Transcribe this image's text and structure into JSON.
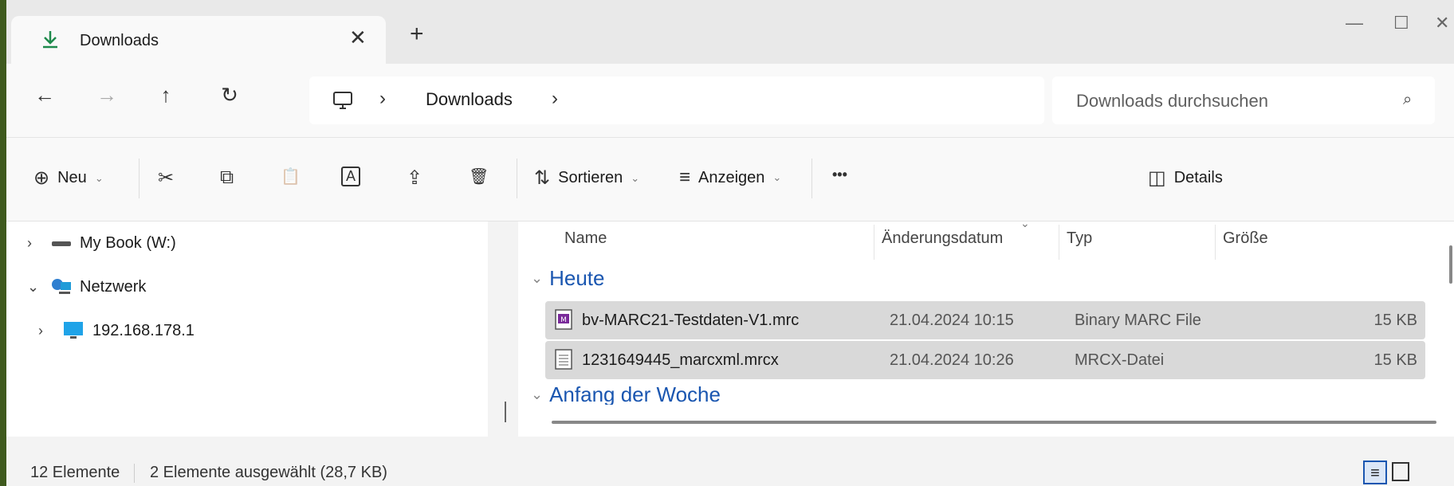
{
  "tab": {
    "title": "Downloads",
    "icon": "download-icon",
    "close": "✕",
    "new": "+"
  },
  "window_controls": {
    "minimize": "—",
    "maximize": "☐",
    "close": "✕"
  },
  "nav": {
    "back": "←",
    "forward": "→",
    "up": "↑",
    "refresh": "↻",
    "breadcrumb_sep": "›",
    "breadcrumb": "Downloads",
    "breadcrumb_end": "›",
    "search_placeholder": "Downloads durchsuchen",
    "search_icon": "⌕"
  },
  "toolbar": {
    "new_icon": "⊕",
    "new_label": "Neu",
    "chevron": "⌄",
    "cut_icon": "✂",
    "copy_icon": "⧉",
    "paste_icon": "📋",
    "rename_icon": "A",
    "share_icon": "⇪",
    "delete_icon": "🗑",
    "sort_icon": "⇅",
    "sort_label": "Sortieren",
    "view_icon": "≡",
    "view_label": "Anzeigen",
    "more": "•••",
    "details_icon": "◫",
    "details_label": "Details"
  },
  "tree": [
    {
      "label": "My Book (W:)",
      "chev": "›",
      "icon": "drive-icon"
    },
    {
      "label": "Netzwerk",
      "chev": "⌄",
      "icon": "network-icon"
    },
    {
      "label": "192.168.178.1",
      "chev": "›",
      "icon": "computer-icon"
    }
  ],
  "columns": {
    "name": "Name",
    "date": "Änderungsdatum",
    "type": "Typ",
    "size": "Größe",
    "sort_caret": "⌄"
  },
  "groups": [
    {
      "label": "Heute",
      "chev": "⌄"
    },
    {
      "label": "Anfang der Woche",
      "chev": "⌄"
    }
  ],
  "files": [
    {
      "name": "bv-MARC21-Testdaten-V1.mrc",
      "date": "21.04.2024 10:15",
      "type": "Binary MARC File",
      "size": "15 KB",
      "icon": "marc-file-icon",
      "selected": true
    },
    {
      "name": "1231649445_marcxml.mrcx",
      "date": "21.04.2024 10:26",
      "type": "MRCX-Datei",
      "size": "15 KB",
      "icon": "document-icon",
      "selected": true
    }
  ],
  "status": {
    "count": "12 Elemente",
    "selection": "2 Elemente ausgewählt (28,7 KB)"
  },
  "colors": {
    "accent": "#1a56b0",
    "selection": "#d9d9d9",
    "download_green": "#1e8a4c"
  }
}
